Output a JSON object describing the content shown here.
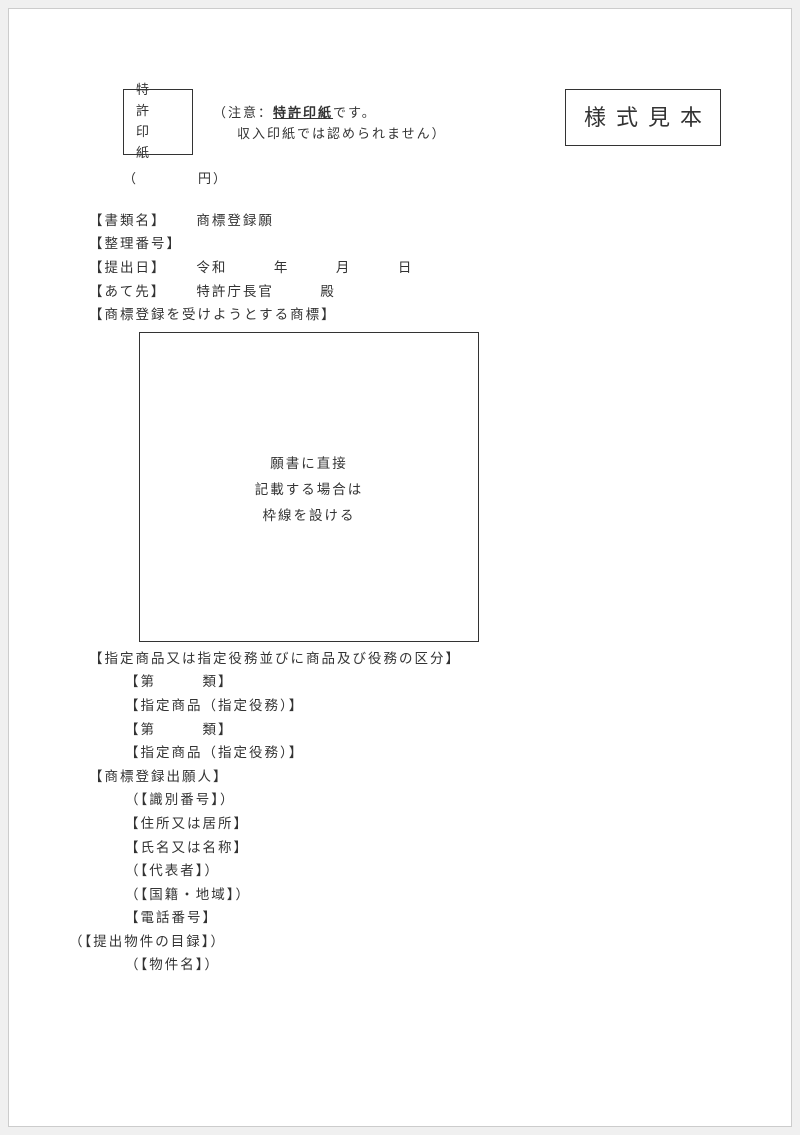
{
  "stamp": {
    "line1": "特　許",
    "line2": "印　紙"
  },
  "note": {
    "prefix": "（注意：",
    "bold": "特許印紙",
    "suffix": "です。",
    "line2": "収入印紙では認められません）"
  },
  "sample_badge": "様式見本",
  "price": "（　　　　円）",
  "fields": {
    "doc_name_label": "【書類名】",
    "doc_name_value": "商標登録願",
    "ref_no_label": "【整理番号】",
    "submit_date_label": "【提出日】",
    "submit_date_value": "令和　　　年　　　月　　　日",
    "addressee_label": "【あて先】",
    "addressee_value": "特許庁長官　　　殿",
    "trademark_section": "【商標登録を受けようとする商標】"
  },
  "trademark_box": {
    "line1": "願書に直接",
    "line2": "記載する場合は",
    "line3": "枠線を設ける"
  },
  "goods": {
    "section": "【指定商品又は指定役務並びに商品及び役務の区分】",
    "class_label": "【第　　　類】",
    "goods_label": "【指定商品（指定役務）】"
  },
  "applicant": {
    "section": "【商標登録出願人】",
    "id_no": "（【識別番号】）",
    "address": "【住所又は居所】",
    "name": "【氏名又は名称】",
    "rep": "（【代表者】）",
    "nationality": "（【国籍・地域】）",
    "phone": "【電話番号】"
  },
  "attachments": {
    "section": "（【提出物件の目録】）",
    "item": "（【物件名】）"
  }
}
